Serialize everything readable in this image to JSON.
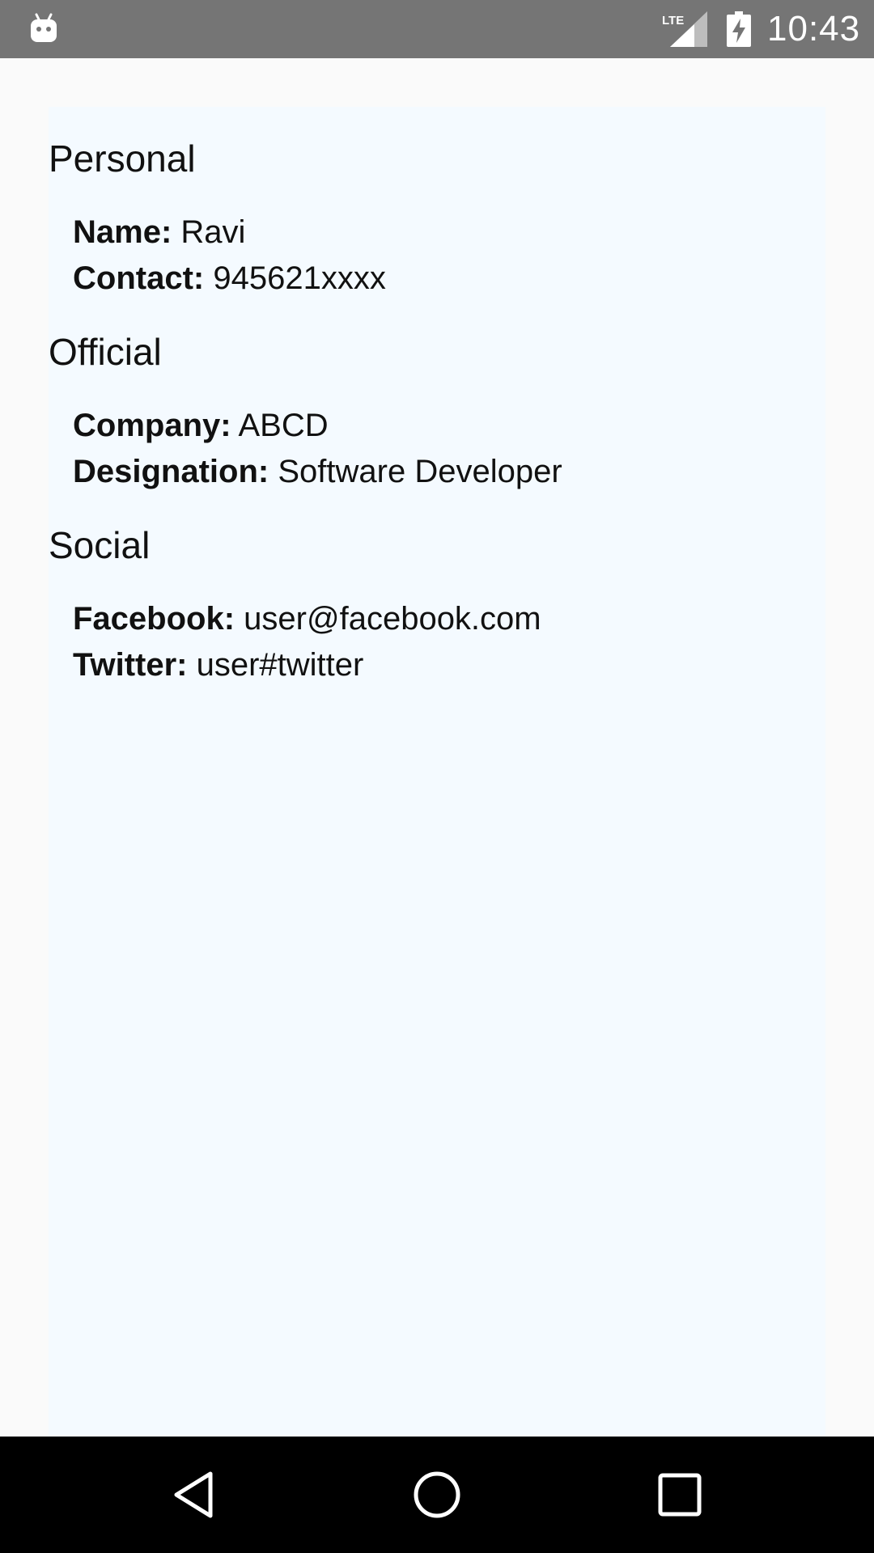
{
  "status_bar": {
    "network": "LTE",
    "time": "10:43"
  },
  "sections": [
    {
      "title": "Personal",
      "fields": [
        {
          "label": "Name:",
          "value": "Ravi"
        },
        {
          "label": "Contact:",
          "value": "945621xxxx"
        }
      ]
    },
    {
      "title": "Official",
      "fields": [
        {
          "label": "Company:",
          "value": "ABCD"
        },
        {
          "label": "Designation:",
          "value": "Software Developer"
        }
      ]
    },
    {
      "title": "Social",
      "fields": [
        {
          "label": "Facebook:",
          "value": "user@facebook.com"
        },
        {
          "label": "Twitter:",
          "value": "user#twitter"
        }
      ]
    }
  ],
  "icons": {
    "status_left": "android-icon",
    "signal": "lte-signal-icon",
    "battery": "battery-charging-icon",
    "nav_back": "back-icon",
    "nav_home": "home-icon",
    "nav_recents": "recents-icon"
  }
}
